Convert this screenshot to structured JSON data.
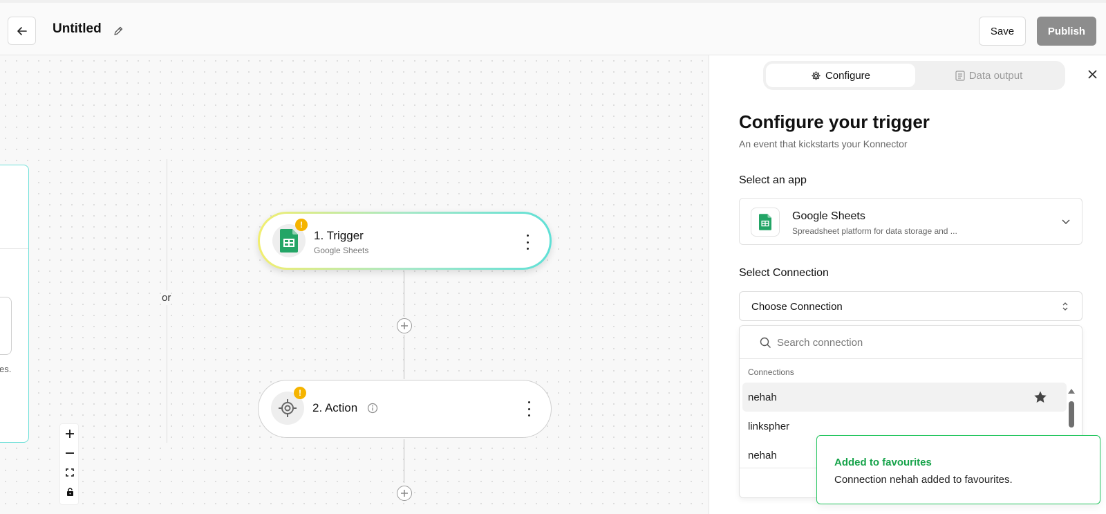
{
  "header": {
    "title": "Untitled",
    "save_label": "Save",
    "publish_label": "Publish"
  },
  "canvas": {
    "or_label": "or",
    "left_card_fragment": "es.",
    "nodes": [
      {
        "title": "1. Trigger",
        "subtitle": "Google Sheets",
        "badge": "!"
      },
      {
        "title": "2. Action",
        "badge": "!"
      }
    ]
  },
  "panel": {
    "tabs": [
      {
        "label": "Configure",
        "active": true
      },
      {
        "label": "Data output",
        "active": false
      }
    ],
    "title": "Configure your trigger",
    "subtitle": "An event that kickstarts your Konnector",
    "select_app_label": "Select an app",
    "app": {
      "name": "Google Sheets",
      "description": "Spreadsheet platform for data storage and ..."
    },
    "select_connection_label": "Select Connection",
    "connection_value": "Choose Connection",
    "search_placeholder": "Search connection",
    "connections_group_label": "Connections",
    "connections": [
      {
        "name": "nehah",
        "favourite": true
      },
      {
        "name": "linkspher",
        "favourite": false
      },
      {
        "name": "nehah",
        "favourite": false
      }
    ]
  },
  "toast": {
    "title": "Added to favourites",
    "message": "Connection nehah added to favourites."
  },
  "colors": {
    "accent_green": "#16a34a",
    "publish_bg": "#8d8d8d",
    "warning_badge": "#f5b400",
    "teal_outline": "#5fe0d6"
  }
}
